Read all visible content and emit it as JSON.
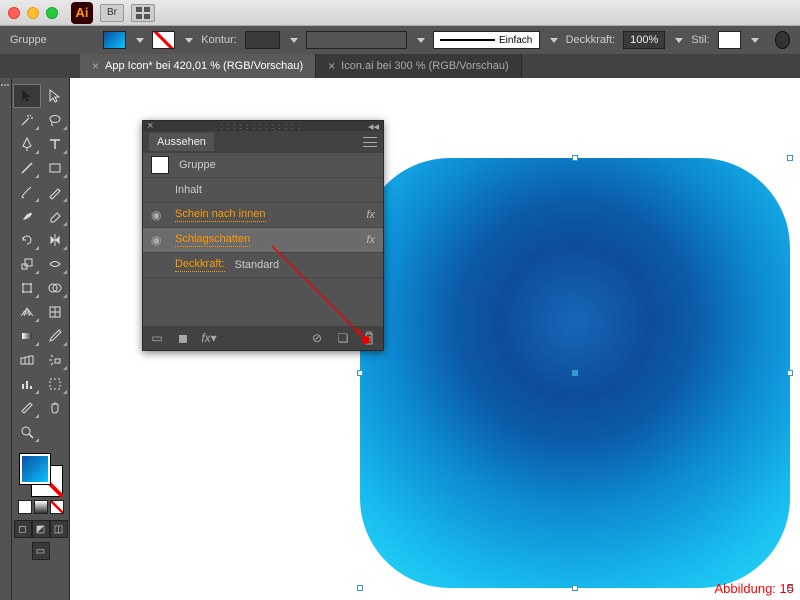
{
  "titlebar": {
    "app_abbrev": "Ai",
    "br_label": "Br"
  },
  "control": {
    "selection_label": "Gruppe",
    "stroke_label": "Kontur:",
    "stroke_style_label": "Einfach",
    "opacity_label": "Deckkraft:",
    "opacity_value": "100%",
    "style_label": "Stil:"
  },
  "tabs": [
    {
      "label": "App Icon* bei 420,01 % (RGB/Vorschau)",
      "active": true
    },
    {
      "label": "Icon.ai bei 300 % (RGB/Vorschau)",
      "active": false
    }
  ],
  "panel": {
    "title": "Aussehen",
    "group_label": "Gruppe",
    "content_label": "Inhalt",
    "inner_glow": "Schein nach innen",
    "drop_shadow": "Schlagschatten",
    "opacity_row_label": "Deckkraft:",
    "opacity_row_value": "Standard",
    "fx_label": "fx"
  },
  "caption": "Abbildung: 15"
}
